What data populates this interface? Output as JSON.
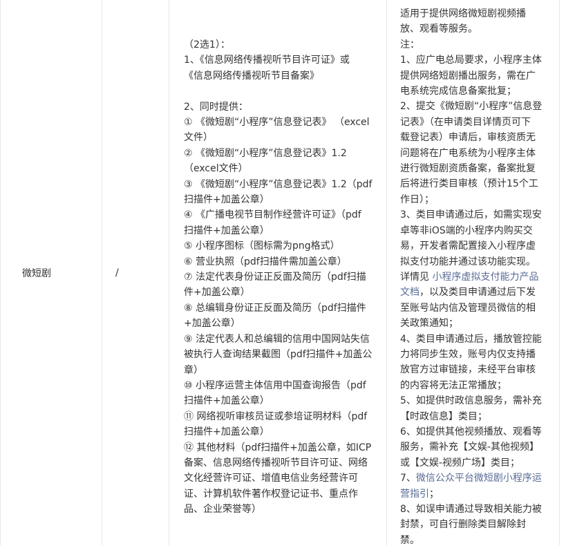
{
  "row": {
    "category": "微短剧",
    "dash": "/",
    "requirements": [
      "（2选1）：",
      "1、《信息网络传播视听节目许可证》或",
      "《信息网络传播视听节目备案》",
      "",
      "2、同时提供：",
      "① 《微短剧“小程序”信息登记表》 （excel",
      "文件）",
      "② 《微短剧“小程序”信息登记表》1.2",
      "（excel文件）",
      "③ 《微短剧“小程序”信息登记表》1.2（pdf",
      "扫描件+加盖公章）",
      "④ 《广播电视节目制作经营许可证》（pdf",
      "扫描件+加盖公章）",
      "⑤ 小程序图标（图标需为png格式）",
      "⑥ 营业执照（pdf扫描件需加盖公章）",
      "⑦ 法定代表身份证正反面及简历（pdf扫描",
      "件+加盖公章）",
      "⑧ 总编辑身份证正反面及简历（pdf扫描件",
      "+加盖公章）",
      "⑨ 法定代表人和总编辑的信用中国网站失信",
      "被执行人查询结果截图（pdf扫描件+加盖公",
      "章）",
      "⑩ 小程序运营主体信用中国查询报告（pdf",
      "扫描件+加盖公章）",
      "⑪ 网络视听审核员证或参培证明材料（pdf",
      "扫描件+加盖公章）",
      "⑫ 其他材料（pdf扫描件+加盖公章，如ICP",
      "备案、信息网络传播视听节目许可证、网络",
      "文化经营许可证、增值电信业务经营许可",
      "证、计算机软件著作权登记证书、重点作",
      "品、企业荣誉等）"
    ],
    "notes": [
      [
        {
          "t": "适用于提供网络微短剧视频播"
        }
      ],
      [
        {
          "t": "放、观看等服务。"
        }
      ],
      [
        {
          "t": "注："
        }
      ],
      [
        {
          "t": "1、应广电总局要求，小程序主体"
        }
      ],
      [
        {
          "t": "提供网络短剧播出服务，需在广"
        }
      ],
      [
        {
          "t": "电系统完成信息备案批复；"
        }
      ],
      [
        {
          "t": "2、提交《微短剧“小程序”信息登"
        }
      ],
      [
        {
          "t": "记表》（在申请类目详情页可下"
        }
      ],
      [
        {
          "t": "载登记表）申请后，审核资质无"
        }
      ],
      [
        {
          "t": "问题将在广电系统为小程序主体"
        }
      ],
      [
        {
          "t": "进行微短剧资质备案，备案批复"
        }
      ],
      [
        {
          "t": "后将进行类目审核（预计15个工"
        }
      ],
      [
        {
          "t": "作日）；"
        }
      ],
      [
        {
          "t": "3、类目申请通过后，如需实现安"
        }
      ],
      [
        {
          "t": "卓等非iOS端的小程序内购买交"
        }
      ],
      [
        {
          "t": "易，开发者需配置接入小程序虚"
        }
      ],
      [
        {
          "t": "拟支付功能并通过该功能实现。"
        }
      ],
      [
        {
          "t": "详情见 "
        },
        {
          "t": "小程序虚拟支付能力产品",
          "link": true
        }
      ],
      [
        {
          "t": "文档",
          "link": true
        },
        {
          "t": "，以及类目申请通过后下发"
        }
      ],
      [
        {
          "t": "至账号站内信及管理员微信的相"
        }
      ],
      [
        {
          "t": "关政策通知；"
        }
      ],
      [
        {
          "t": "4、类目申请通过后，播放管控能"
        }
      ],
      [
        {
          "t": "力将同步生效，账号内仅支持播"
        }
      ],
      [
        {
          "t": "放官方过审链接，未经平台审核"
        }
      ],
      [
        {
          "t": "的内容将无法正常播放；"
        }
      ],
      [
        {
          "t": "5、如提供时政信息服务，需补充"
        }
      ],
      [
        {
          "t": "【时政信息】类目；"
        }
      ],
      [
        {
          "t": "6、如提供其他视频播放、观看等"
        }
      ],
      [
        {
          "t": "服务，需补充【文娱-其他视频】"
        }
      ],
      [
        {
          "t": "或【文娱-视频广场】类目；"
        }
      ],
      [
        {
          "t": "7、"
        },
        {
          "t": "微信公众平台微短剧小程序运",
          "link": true
        }
      ],
      [
        {
          "t": "营指引",
          "link": true
        },
        {
          "t": "；"
        }
      ],
      [
        {
          "t": "8、如误申请通过导致相关能力被"
        }
      ],
      [
        {
          "t": "封禁，可自行删除类目解除封"
        }
      ],
      [
        {
          "t": "禁。"
        }
      ]
    ]
  },
  "colors": {
    "text": "#333333",
    "link": "#576b95",
    "border": "#e6e6e6"
  }
}
